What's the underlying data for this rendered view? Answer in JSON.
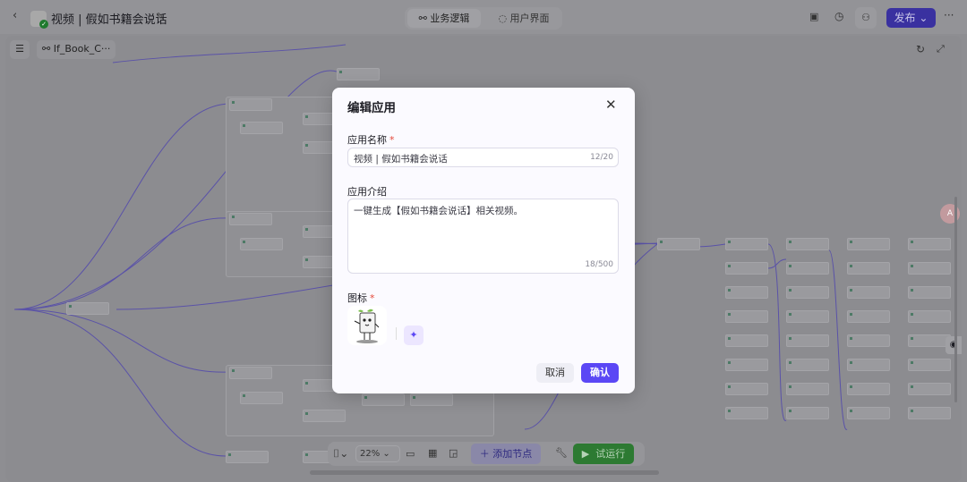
{
  "header": {
    "app_title": "视频 | 假如书籍会说话",
    "tabs": [
      {
        "label": "业务逻辑",
        "active": true
      },
      {
        "label": "用户界面",
        "active": false
      }
    ],
    "publish_label": "发布"
  },
  "canvas": {
    "breadcrumb": "If_Book_C···",
    "zoom": "22%",
    "add_node_label": "添加节点",
    "run_label": "试运行"
  },
  "modal": {
    "title": "编辑应用",
    "name_label": "应用名称",
    "name_value": "视频 | 假如书籍会说话",
    "name_count": "12/20",
    "desc_label": "应用介绍",
    "desc_value": "一键生成【假如书籍会说话】相关视频。",
    "desc_count": "18/500",
    "icon_label": "图标",
    "required_mark": "*",
    "cancel_label": "取消",
    "confirm_label": "确认"
  },
  "colors": {
    "accent": "#5b47f5",
    "run": "#2d7a32"
  }
}
